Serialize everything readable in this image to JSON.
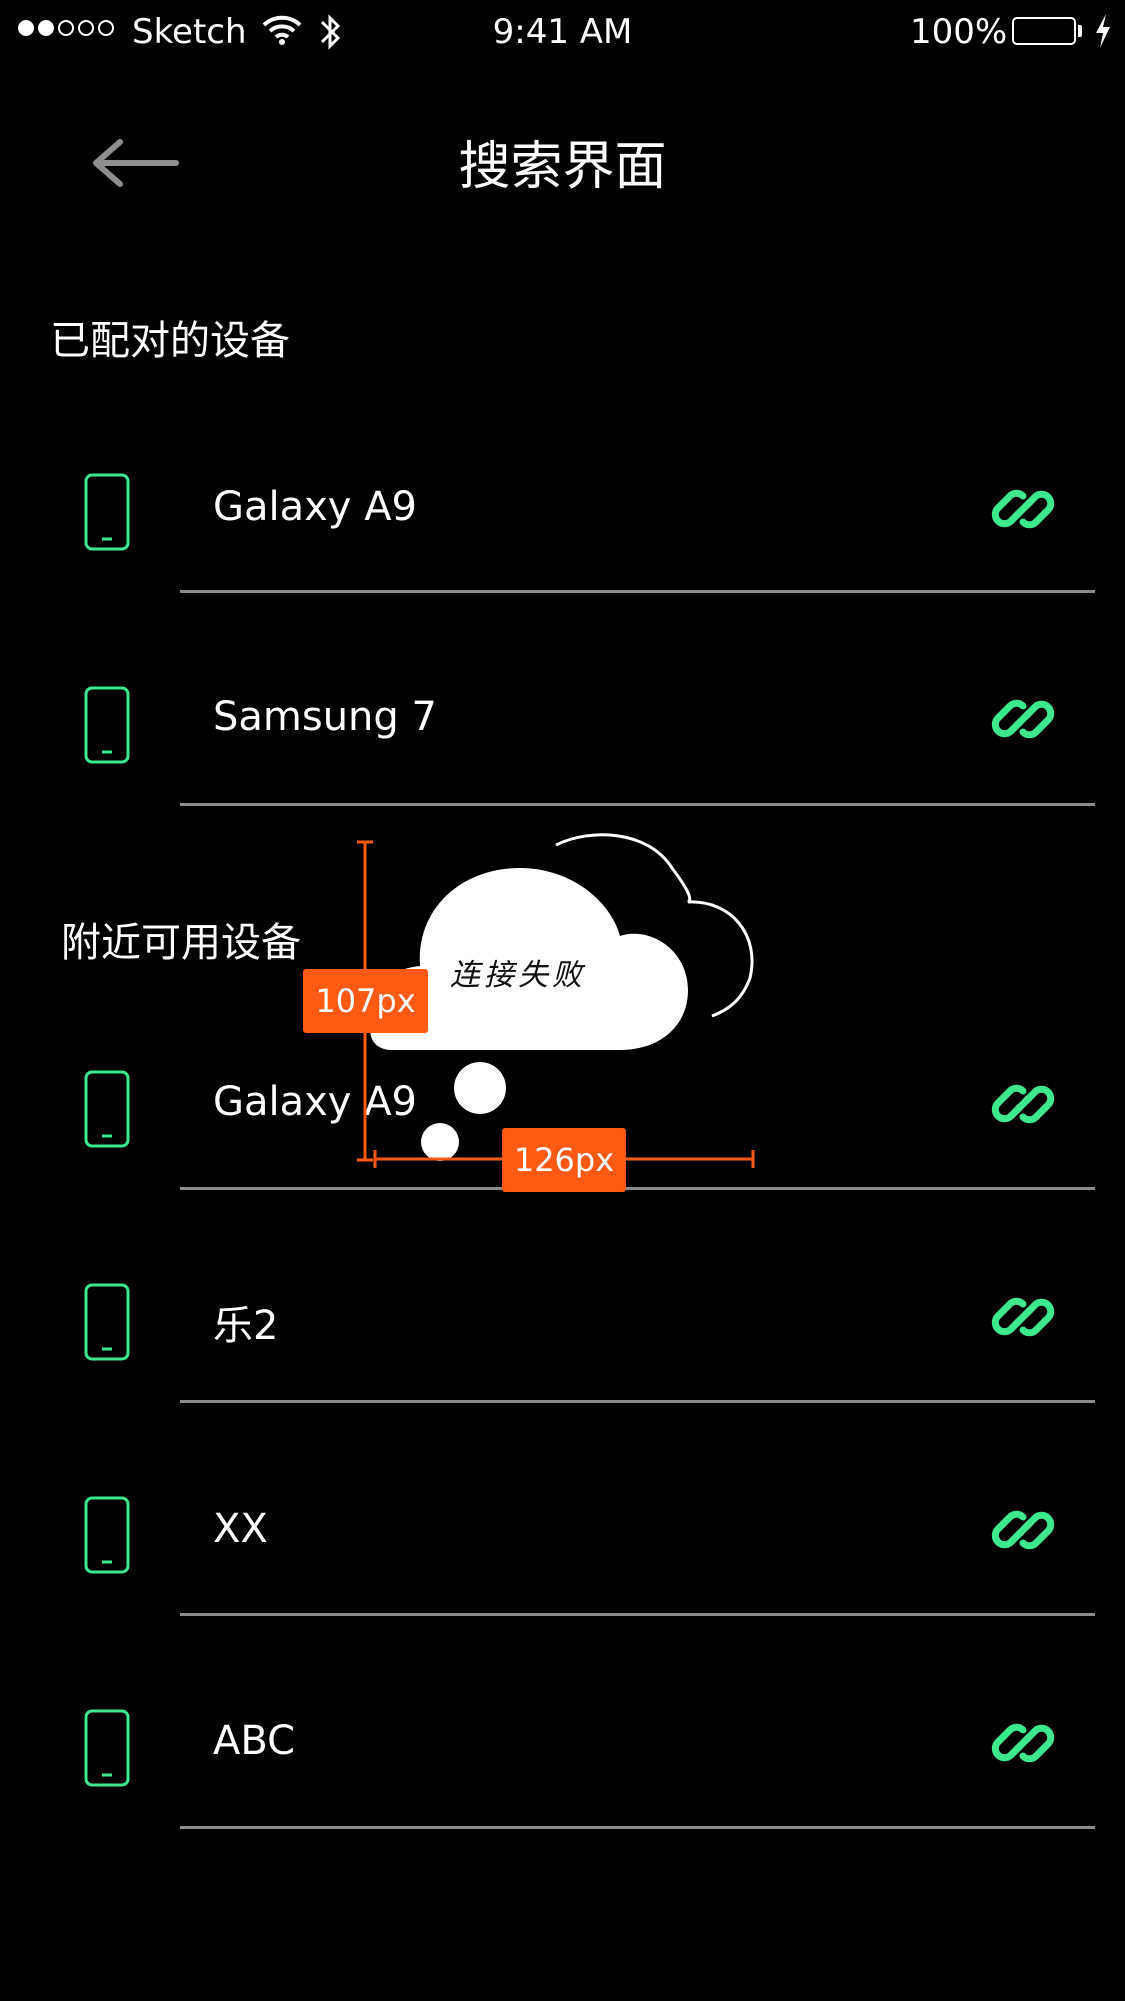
{
  "status_bar": {
    "carrier": "Sketch",
    "time": "9:41 AM",
    "battery_percent": "100%",
    "signal_dots_filled": 2,
    "signal_dots_total": 5,
    "battery_color": "#4cd964"
  },
  "nav": {
    "back_icon": "arrow-left-icon",
    "title": "搜索界面"
  },
  "paired": {
    "heading": "已配对的设备",
    "devices": [
      {
        "name": "Galaxy A9"
      },
      {
        "name": "Samsung 7"
      }
    ]
  },
  "nearby": {
    "heading": "附近可用设备",
    "devices": [
      {
        "name": "Galaxy A9"
      },
      {
        "name": "乐2"
      },
      {
        "name": "XX"
      },
      {
        "name": "ABC"
      }
    ]
  },
  "icons": {
    "device": "phone-icon",
    "connect": "link-icon"
  },
  "annotation": {
    "bubble_text": "连接失败",
    "height_label": "107px",
    "width_label": "126px"
  },
  "colors": {
    "accent_green": "#3ee88f",
    "annotation_orange": "#ff5a14",
    "divider": "#8a8a8a",
    "background": "#000000"
  }
}
